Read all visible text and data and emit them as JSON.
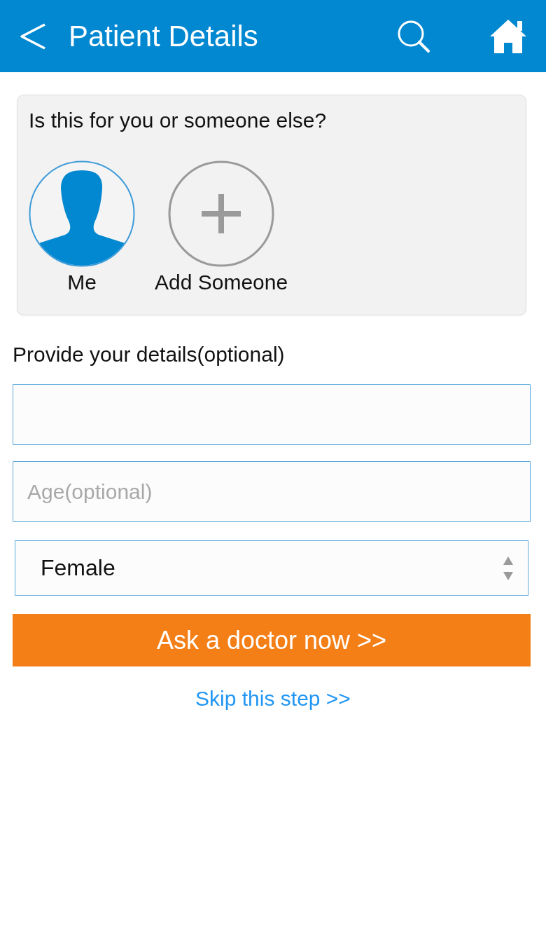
{
  "header": {
    "title": "Patient Details"
  },
  "recipient_card": {
    "question": "Is this for you or someone else?",
    "options": [
      {
        "label": "Me",
        "kind": "self",
        "selected": true
      },
      {
        "label": "Add Someone",
        "kind": "add",
        "selected": false
      }
    ]
  },
  "details_section": {
    "heading": "Provide your details(optional)",
    "fields": [
      {
        "kind": "text"
      },
      {
        "kind": "text",
        "placeholder": "Age(optional)"
      },
      {
        "kind": "select",
        "value": "Female"
      }
    ]
  },
  "primary_button": {
    "label": "Ask a doctor now >>"
  },
  "skip_link": {
    "label": "Skip this step >>"
  }
}
